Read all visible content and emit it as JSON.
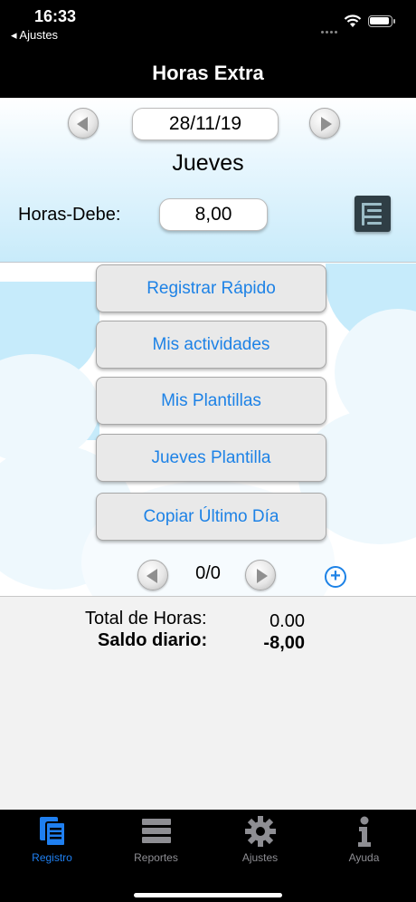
{
  "status_bar": {
    "time": "16:33",
    "back_label": "◂ Ajustes"
  },
  "navbar": {
    "title": "Horas Extra"
  },
  "date": {
    "value": "28/11/19",
    "day": "Jueves"
  },
  "hours_debe": {
    "label": "Horas-Debe:",
    "value": "8,00"
  },
  "menu": [
    {
      "label": "Registrar Rápido"
    },
    {
      "label": "Mis actividades"
    },
    {
      "label": "Mis Plantillas"
    },
    {
      "label": "Jueves Plantilla"
    },
    {
      "label": "Copiar Último Día"
    }
  ],
  "pager": {
    "text": "0/0"
  },
  "totals": {
    "total_label": "Total de Horas:",
    "total_value": "0.00",
    "saldo_label": "Saldo diario:",
    "saldo_value": "-8,00"
  },
  "tabs": [
    {
      "label": "Registro",
      "icon": "document-icon",
      "active": true
    },
    {
      "label": "Reportes",
      "icon": "list-icon",
      "active": false
    },
    {
      "label": "Ajustes",
      "icon": "gear-icon",
      "active": false
    },
    {
      "label": "Ayuda",
      "icon": "info-icon",
      "active": false
    }
  ],
  "colors": {
    "accent": "#1f7ff0",
    "link": "#1d82e6",
    "sky": "#c6ebfb"
  }
}
